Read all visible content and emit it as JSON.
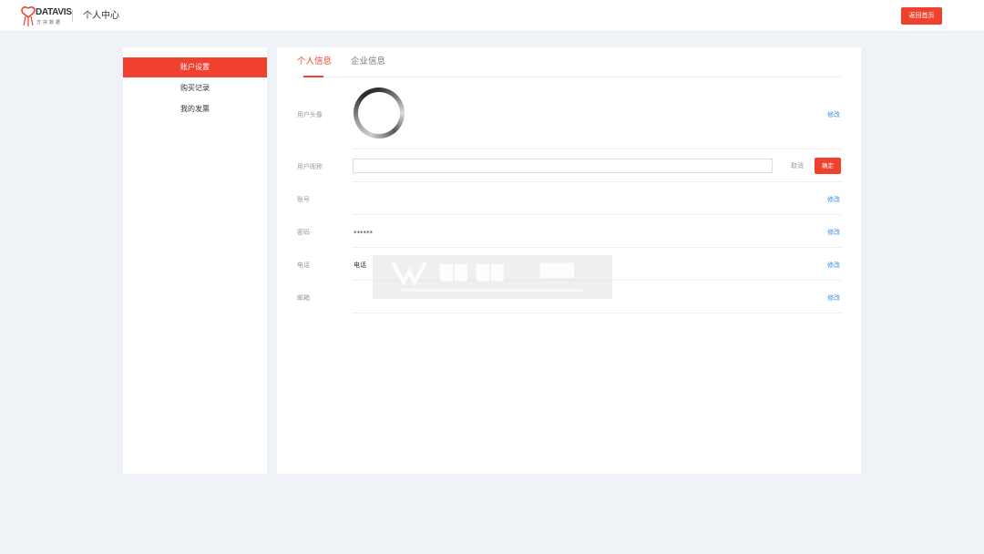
{
  "header": {
    "logo_text": "DATAVIS",
    "logo_sub": "方块数据",
    "title": "个人中心",
    "back_label": "返回首页"
  },
  "sidebar": {
    "items": [
      {
        "label": "账户设置",
        "active": true
      },
      {
        "label": "购买记录",
        "active": false
      },
      {
        "label": "我的发票",
        "active": false
      }
    ]
  },
  "tabs": [
    {
      "label": "个人信息",
      "active": true
    },
    {
      "label": "企业信息",
      "active": false
    }
  ],
  "form": {
    "avatar_label": "用户头像",
    "nickname_label": "用户昵称",
    "nickname_value": "",
    "cancel_label": "取消",
    "confirm_label": "确定",
    "account_label": "账号",
    "account_value": "",
    "password_label": "密码",
    "password_value": "******",
    "phone_label": "电话",
    "phone_value": "电话",
    "email_label": "邮箱",
    "email_value": "",
    "modify_label": "修改"
  },
  "colors": {
    "accent": "#f0412f",
    "link": "#3a8ee6",
    "background": "#eff2f7"
  }
}
